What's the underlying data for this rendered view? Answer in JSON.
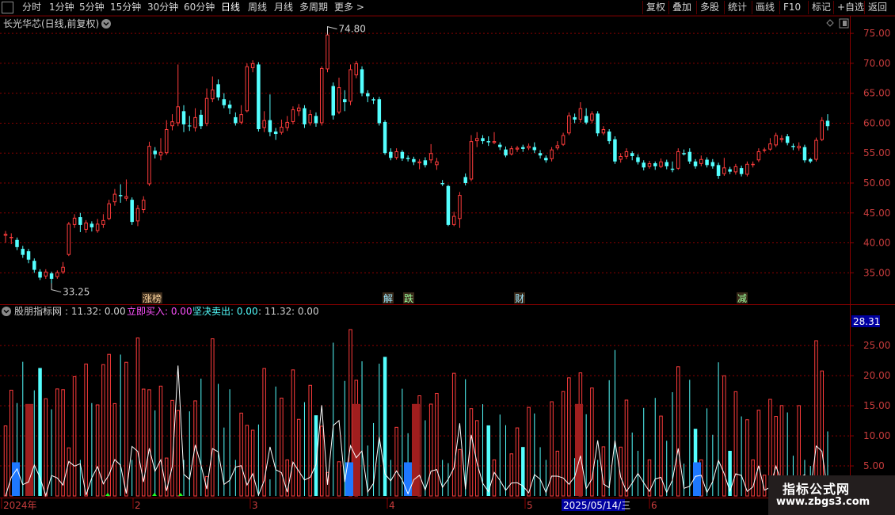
{
  "toolbar": {
    "left_items": [
      "分时",
      "1分钟",
      "5分钟",
      "15分钟",
      "30分钟",
      "60分钟",
      "日线",
      "周线",
      "月线",
      "多周期",
      "更多 >"
    ],
    "active_item": "日线",
    "right_items": [
      "复权",
      "叠加",
      "多股",
      "统计",
      "画线",
      "F10",
      "标记",
      "+自选",
      "返回"
    ]
  },
  "main_panel": {
    "title": "长光华芯(日线,前复权)",
    "high_label": "74.80",
    "low_label": "33.25",
    "y_ticks": [
      "75.00",
      "70.00",
      "65.00",
      "60.00",
      "55.00",
      "50.00",
      "45.00",
      "40.00",
      "35.00"
    ],
    "event_markers": [
      {
        "label": "涨榜",
        "color": "#ffd7a0"
      },
      {
        "label": "解",
        "color": "#9be7ff"
      },
      {
        "label": "跌",
        "color": "#9cff9c"
      },
      {
        "label": "财",
        "color": "#9be7ff"
      },
      {
        "label": "减",
        "color": "#9cff9c"
      }
    ]
  },
  "indicator_panel": {
    "name": "股朋指标网",
    "value1": ": 11.32",
    "value2": ": 0.00",
    "buy_label": "立即买入",
    "buy_value": ": 0.00",
    "sell_label": "坚决卖出",
    "sell_value": ": 0.00",
    "value3": ": 11.32",
    "value4": ": 0.00",
    "current_value": "28.31",
    "y_ticks": [
      "25.00",
      "20.00",
      "15.00",
      "10.00",
      "5.00"
    ]
  },
  "time_axis": {
    "labels": [
      "2024年",
      "2",
      "3",
      "4",
      "5",
      "6"
    ],
    "cursor_date": "2025/05/14/三"
  },
  "watermark": {
    "title": "指标公式网",
    "url": "www.zbgs3.com"
  },
  "colors": {
    "up": "#ff3c3c",
    "down": "#54ffff",
    "grid": "#8b0000",
    "axis_text": "#c83c3c",
    "purple": "#ff50ff",
    "cyan": "#54ffff",
    "dark_red": "#a01e1e",
    "blue": "#1e78ff"
  },
  "chart_data": {
    "type": "candlestick",
    "title": "长光华芯(日线,前复权)",
    "ylim": [
      32,
      77
    ],
    "annotated_high": 74.8,
    "annotated_low": 33.25,
    "candles": [
      [
        41.2,
        41.5,
        40.0,
        42.0
      ],
      [
        40.8,
        41.0,
        39.8,
        41.6
      ],
      [
        40.5,
        39.3,
        38.8,
        40.9
      ],
      [
        39.0,
        38.0,
        37.5,
        39.5
      ],
      [
        38.6,
        37.2,
        36.6,
        39.0
      ],
      [
        37.0,
        35.5,
        35.0,
        37.4
      ],
      [
        35.2,
        34.2,
        33.8,
        35.6
      ],
      [
        34.4,
        35.2,
        34.0,
        35.6
      ],
      [
        34.9,
        34.0,
        33.25,
        35.2
      ],
      [
        34.3,
        35.1,
        34.0,
        35.4
      ],
      [
        35.1,
        36.0,
        34.8,
        36.8
      ],
      [
        38.0,
        43.2,
        37.8,
        43.5
      ],
      [
        43.0,
        44.2,
        42.5,
        44.8
      ],
      [
        44.3,
        43.0,
        41.8,
        45.0
      ],
      [
        42.2,
        43.4,
        41.7,
        43.8
      ],
      [
        43.2,
        42.6,
        41.9,
        43.6
      ],
      [
        42.0,
        43.2,
        41.7,
        44.0
      ],
      [
        43.0,
        43.8,
        42.5,
        44.8
      ],
      [
        44.0,
        46.6,
        43.8,
        47.2
      ],
      [
        46.8,
        48.2,
        46.2,
        49.0
      ],
      [
        48.0,
        47.8,
        46.7,
        49.8
      ],
      [
        47.4,
        47.8,
        47.0,
        50.6
      ],
      [
        47.2,
        43.5,
        43.0,
        47.6
      ],
      [
        43.6,
        45.8,
        42.8,
        46.3
      ],
      [
        45.5,
        47.2,
        45.0,
        47.8
      ],
      [
        49.8,
        56.2,
        49.5,
        56.9
      ],
      [
        55.4,
        54.8,
        54.1,
        56.0
      ],
      [
        54.6,
        55.2,
        53.8,
        57.5
      ],
      [
        55.0,
        59.0,
        54.7,
        60.5
      ],
      [
        59.5,
        60.3,
        58.8,
        61.5
      ],
      [
        60.0,
        62.8,
        59.5,
        69.8
      ],
      [
        62.0,
        59.8,
        58.5,
        63.0
      ],
      [
        59.6,
        59.5,
        58.7,
        61.2
      ],
      [
        59.2,
        61.0,
        58.6,
        62.5
      ],
      [
        61.4,
        59.5,
        59.0,
        62.2
      ],
      [
        59.9,
        64.2,
        59.5,
        65.8
      ],
      [
        64.0,
        65.6,
        63.5,
        67.8
      ],
      [
        66.5,
        64.3,
        63.8,
        67.3
      ],
      [
        64.0,
        63.0,
        62.5,
        65.0
      ],
      [
        63.1,
        62.5,
        61.5,
        63.8
      ],
      [
        61.0,
        60.0,
        59.6,
        61.8
      ],
      [
        60.1,
        61.5,
        59.8,
        63.0
      ],
      [
        62.0,
        69.5,
        61.8,
        70.0
      ],
      [
        69.2,
        70.0,
        68.5,
        70.5
      ],
      [
        69.8,
        59.0,
        58.6,
        70.2
      ],
      [
        59.2,
        60.5,
        58.5,
        62.0
      ],
      [
        60.5,
        58.5,
        57.8,
        64.8
      ],
      [
        58.6,
        58.2,
        57.2,
        59.2
      ],
      [
        58.4,
        59.4,
        58.1,
        60.6
      ],
      [
        59.2,
        60.2,
        58.7,
        61.2
      ],
      [
        60.2,
        62.3,
        59.8,
        62.8
      ],
      [
        62.0,
        62.6,
        61.2,
        63.2
      ],
      [
        62.5,
        59.8,
        59.2,
        63.0
      ],
      [
        60.0,
        61.5,
        59.6,
        62.2
      ],
      [
        61.2,
        60.0,
        59.4,
        61.8
      ],
      [
        60.0,
        69.2,
        59.6,
        69.5
      ],
      [
        69.0,
        74.8,
        68.5,
        74.8
      ],
      [
        66.2,
        61.3,
        60.6,
        66.8
      ],
      [
        61.8,
        66.0,
        61.5,
        67.6
      ],
      [
        64.0,
        63.5,
        62.0,
        65.5
      ],
      [
        63.6,
        69.0,
        63.0,
        69.8
      ],
      [
        68.0,
        70.0,
        67.5,
        70.4
      ],
      [
        69.0,
        65.0,
        64.5,
        69.5
      ],
      [
        65.0,
        64.5,
        63.5,
        65.5
      ],
      [
        64.0,
        63.8,
        63.2,
        64.3
      ],
      [
        64.0,
        60.0,
        59.6,
        64.4
      ],
      [
        60.2,
        55.0,
        54.7,
        60.5
      ],
      [
        55.2,
        54.2,
        53.8,
        55.8
      ],
      [
        54.2,
        55.3,
        53.9,
        55.8
      ],
      [
        55.2,
        54.1,
        53.7,
        55.5
      ],
      [
        54.2,
        54.0,
        53.6,
        54.6
      ],
      [
        54.0,
        53.5,
        53.0,
        54.4
      ],
      [
        53.3,
        53.6,
        52.3,
        54.0
      ],
      [
        53.8,
        53.0,
        52.6,
        54.3
      ],
      [
        53.8,
        55.0,
        53.3,
        56.5
      ],
      [
        53.0,
        53.6,
        52.2,
        54.2
      ],
      [
        50.0,
        49.8,
        49.5,
        50.5
      ],
      [
        49.5,
        43.0,
        42.8,
        49.7
      ],
      [
        43.0,
        44.5,
        42.8,
        45.2
      ],
      [
        44.0,
        48.0,
        42.5,
        48.5
      ],
      [
        51.0,
        50.0,
        49.6,
        51.6
      ],
      [
        50.6,
        57.0,
        50.3,
        58.0
      ],
      [
        57.0,
        57.5,
        56.0,
        58.5
      ],
      [
        57.5,
        57.0,
        56.5,
        58.0
      ],
      [
        57.0,
        56.8,
        56.2,
        57.8
      ],
      [
        56.7,
        57.0,
        56.5,
        58.5
      ],
      [
        56.4,
        56.0,
        55.5,
        56.8
      ],
      [
        55.6,
        54.6,
        54.3,
        56.1
      ],
      [
        54.8,
        55.8,
        54.6,
        56.2
      ],
      [
        55.6,
        55.9,
        55.2,
        56.2
      ],
      [
        56.0,
        55.7,
        55.2,
        56.4
      ],
      [
        55.8,
        56.2,
        55.5,
        56.6
      ],
      [
        56.0,
        55.5,
        55.0,
        56.8
      ],
      [
        55.0,
        54.6,
        54.1,
        55.5
      ],
      [
        54.2,
        53.8,
        53.4,
        54.6
      ],
      [
        54.0,
        55.6,
        53.6,
        56.0
      ],
      [
        55.8,
        56.3,
        55.5,
        57.0
      ],
      [
        56.4,
        58.0,
        56.2,
        58.4
      ],
      [
        58.3,
        61.3,
        58.0,
        61.8
      ],
      [
        61.0,
        60.6,
        60.0,
        61.6
      ],
      [
        60.6,
        62.5,
        60.1,
        63.5
      ],
      [
        61.2,
        60.1,
        59.8,
        62.5
      ],
      [
        60.4,
        61.6,
        60.0,
        62.0
      ],
      [
        61.6,
        58.3,
        57.8,
        62.0
      ],
      [
        58.3,
        59.0,
        58.0,
        59.5
      ],
      [
        58.6,
        57.0,
        56.5,
        59.0
      ],
      [
        57.3,
        53.6,
        53.2,
        57.8
      ],
      [
        53.9,
        54.5,
        53.4,
        55.0
      ],
      [
        54.4,
        55.3,
        54.0,
        55.8
      ],
      [
        55.0,
        54.5,
        53.8,
        55.3
      ],
      [
        54.3,
        53.5,
        53.1,
        54.8
      ],
      [
        53.4,
        52.6,
        52.1,
        53.8
      ],
      [
        52.7,
        53.3,
        52.4,
        53.7
      ],
      [
        53.3,
        52.8,
        52.2,
        53.6
      ],
      [
        52.7,
        53.6,
        52.5,
        54.1
      ],
      [
        53.5,
        52.8,
        52.3,
        53.9
      ],
      [
        52.4,
        52.2,
        51.8,
        53.6
      ],
      [
        52.4,
        55.3,
        52.2,
        55.8
      ],
      [
        55.0,
        54.8,
        54.6,
        55.6
      ],
      [
        55.2,
        53.6,
        53.2,
        55.8
      ],
      [
        53.6,
        52.8,
        52.4,
        54.0
      ],
      [
        53.2,
        54.0,
        52.8,
        54.6
      ],
      [
        53.9,
        53.0,
        52.6,
        54.3
      ],
      [
        53.5,
        52.8,
        52.4,
        54.0
      ],
      [
        53.0,
        51.2,
        50.7,
        53.4
      ],
      [
        51.5,
        52.6,
        51.2,
        54.2
      ],
      [
        52.3,
        51.9,
        51.5,
        52.7
      ],
      [
        51.8,
        52.8,
        51.4,
        53.2
      ],
      [
        52.5,
        51.5,
        51.1,
        52.9
      ],
      [
        51.4,
        53.2,
        51.1,
        53.6
      ],
      [
        53.0,
        53.2,
        52.6,
        53.6
      ],
      [
        53.8,
        55.3,
        53.5,
        55.8
      ],
      [
        55.4,
        55.6,
        55.1,
        55.9
      ],
      [
        55.6,
        56.6,
        55.4,
        57.5
      ],
      [
        56.3,
        58.0,
        56.0,
        58.4
      ],
      [
        57.2,
        57.5,
        56.8,
        58.0
      ],
      [
        57.8,
        56.7,
        56.3,
        58.2
      ],
      [
        56.2,
        56.0,
        55.5,
        56.6
      ],
      [
        55.8,
        56.2,
        55.4,
        56.8
      ],
      [
        56.0,
        53.8,
        53.4,
        56.4
      ],
      [
        54.0,
        53.6,
        53.3,
        54.2
      ],
      [
        53.9,
        57.2,
        53.6,
        57.6
      ],
      [
        57.2,
        60.5,
        57.0,
        61.0
      ],
      [
        60.4,
        59.5,
        58.8,
        61.5
      ]
    ]
  }
}
